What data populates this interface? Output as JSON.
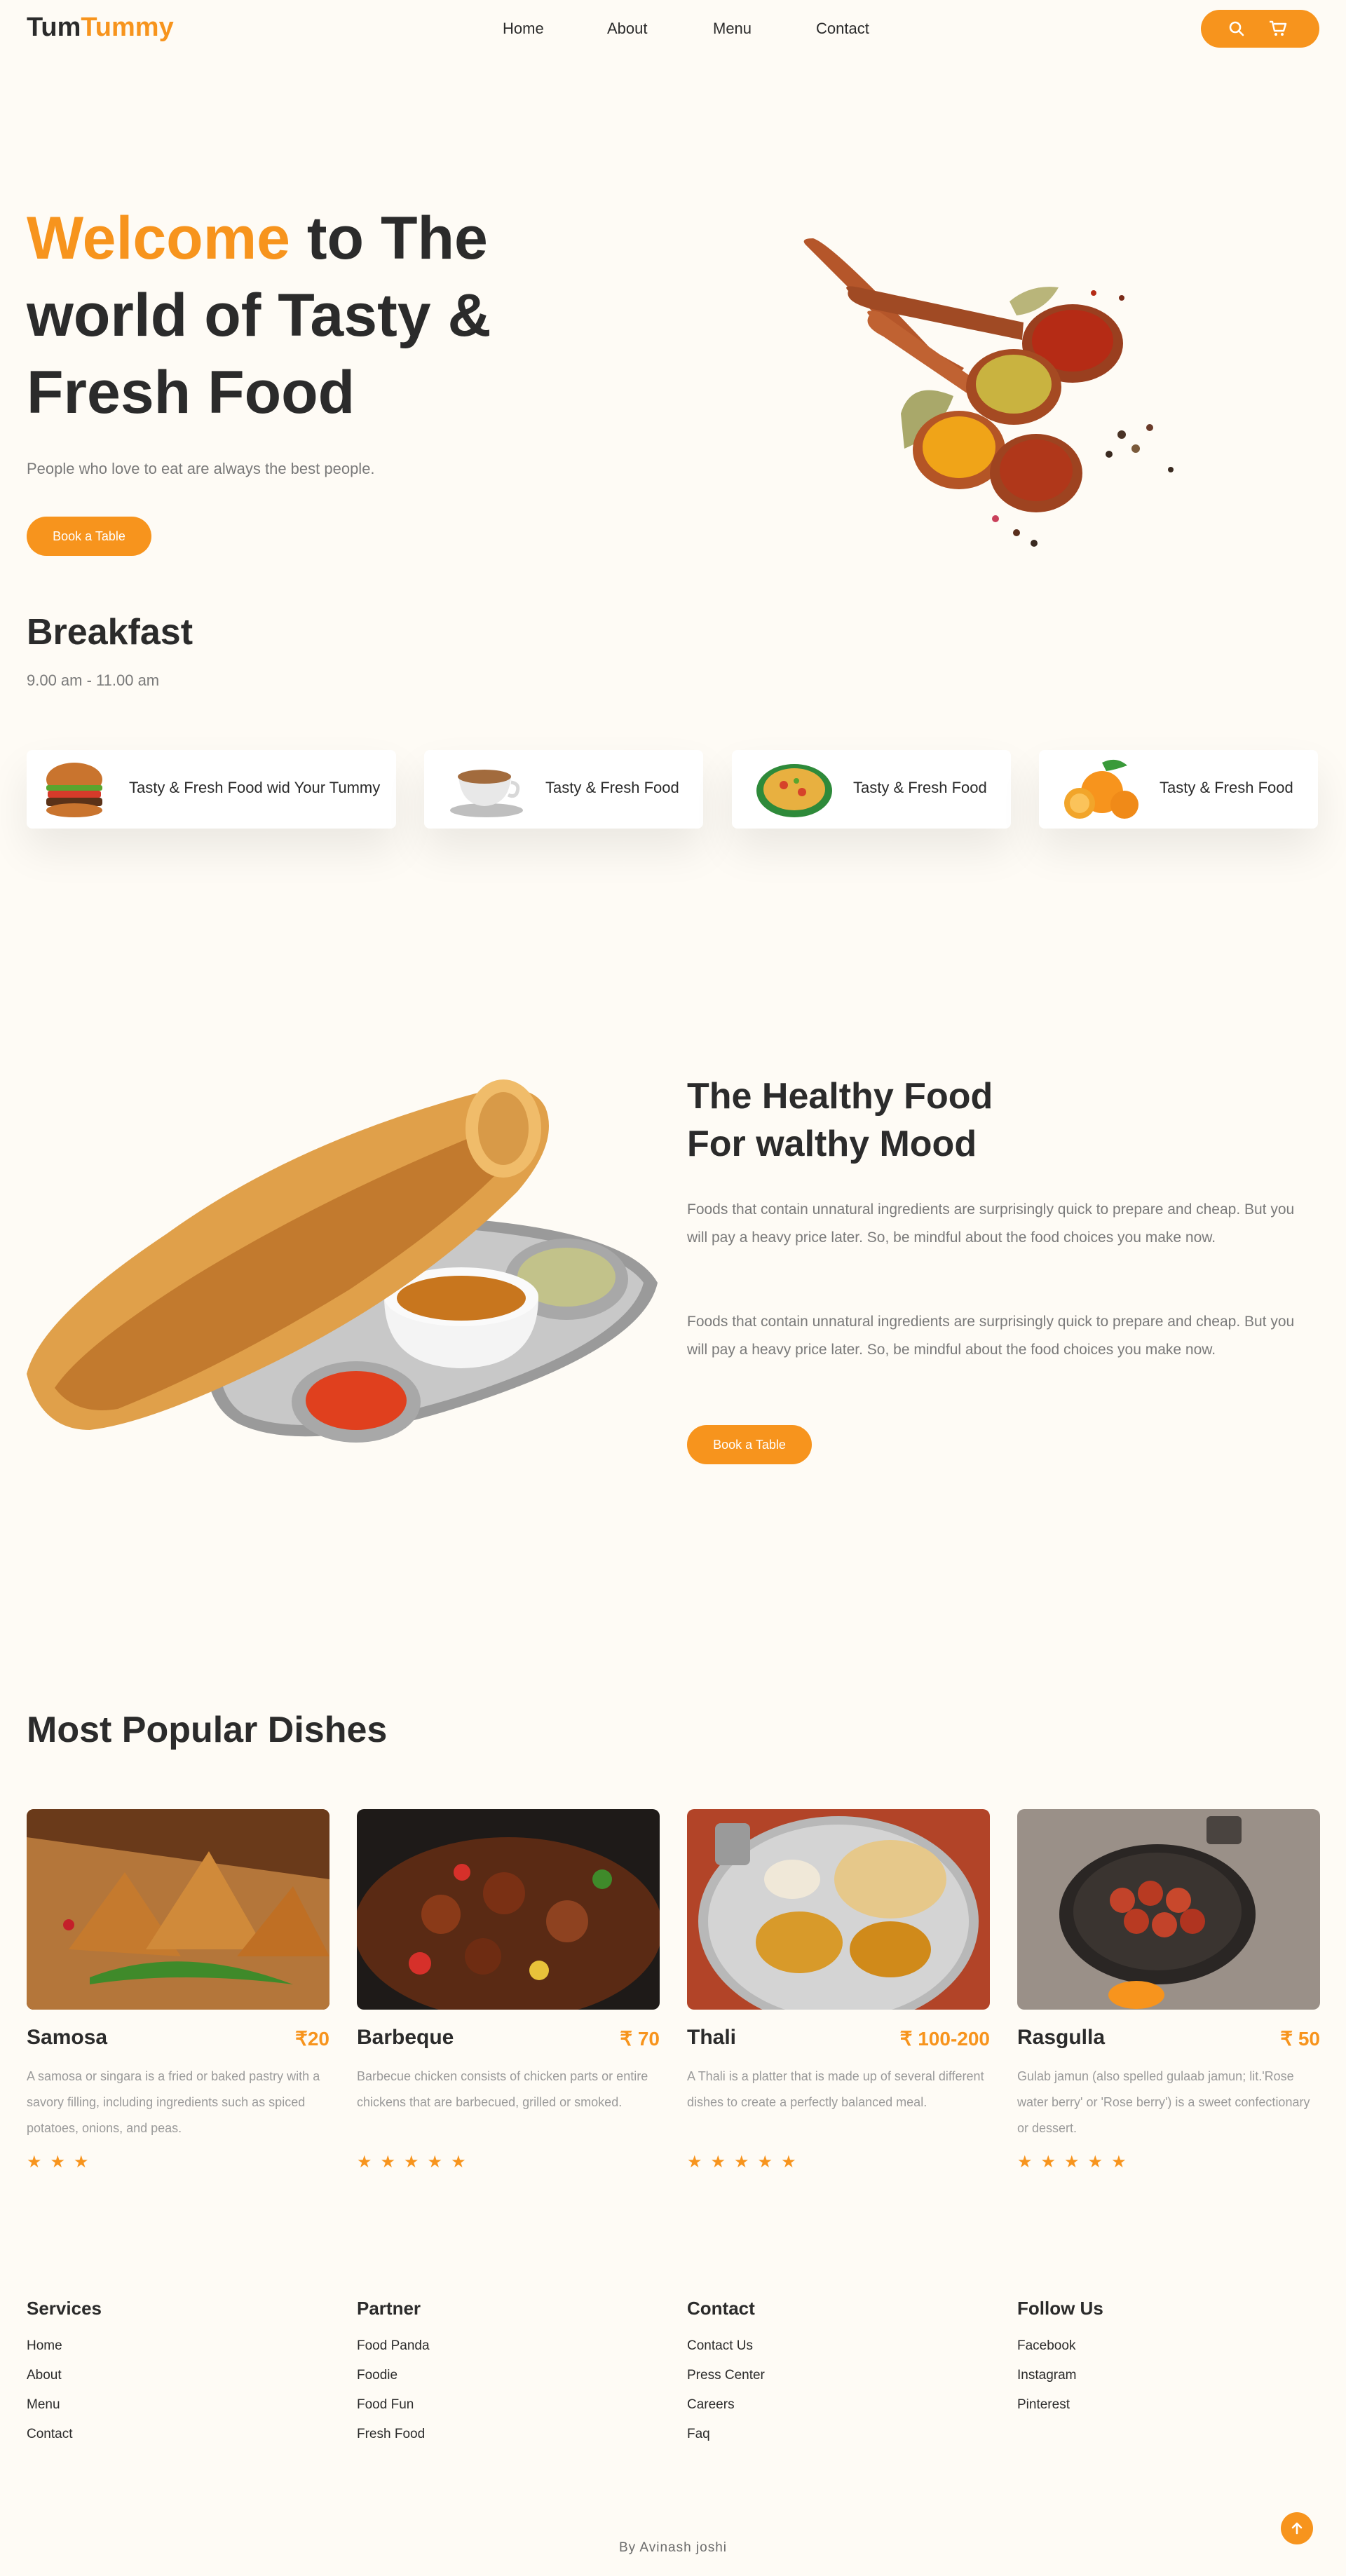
{
  "header": {
    "logo_part1": "Tum",
    "logo_part2": "Tummy",
    "nav": [
      "Home",
      "About",
      "Menu",
      "Contact"
    ],
    "icons": [
      "search-icon",
      "cart-icon"
    ]
  },
  "hero": {
    "title_accent": "Welcome",
    "title_rest": " to The world of Tasty & Fresh Food",
    "subtitle": "People who love to eat are always the best people.",
    "button": "Book a Table"
  },
  "breakfast": {
    "title": "Breakfast",
    "time": "9.00 am - 11.00 am",
    "cards": [
      {
        "label": "Tasty & Fresh Food wid Your Tummy",
        "image": "burger"
      },
      {
        "label": "Tasty & Fresh Food",
        "image": "coffee-cup"
      },
      {
        "label": "Tasty & Fresh Food",
        "image": "rice-bowl"
      },
      {
        "label": "Tasty & Fresh Food",
        "image": "oranges"
      }
    ]
  },
  "healthy": {
    "title_line1": "The Healthy Food",
    "title_line2": "For walthy Mood",
    "para1": "Foods that contain unnatural ingredients are surprisingly quick to prepare and cheap. But you will pay a heavy price later. So, be mindful about the food choices you make now.",
    "para2": "Foods that contain unnatural ingredients are surprisingly quick to prepare and cheap. But you will pay a heavy price later. So, be mindful about the food choices you make now.",
    "button": "Book a Table"
  },
  "popular": {
    "title": "Most Popular Dishes",
    "dishes": [
      {
        "name": "Samosa",
        "price": "₹20",
        "desc": "A samosa or singara is a fried or baked pastry with a savory filling, including ingredients such as spiced potatoes, onions, and peas.",
        "stars": "★★★",
        "rating": 3
      },
      {
        "name": "Barbeque",
        "price": "₹ 70",
        "desc": "Barbecue chicken consists of chicken parts or entire chickens that are barbecued, grilled or smoked.",
        "stars": "★★★★★",
        "rating": 5
      },
      {
        "name": "Thali",
        "price": "₹ 100-200",
        "desc": "A Thali is a platter that is made up of several different dishes to create a perfectly balanced meal.",
        "stars": "★★★★★",
        "rating": 5
      },
      {
        "name": "Rasgulla",
        "price": "₹ 50",
        "desc": "Gulab jamun (also spelled gulaab jamun; lit.'Rose water berry' or 'Rose berry') is a sweet confectionary or dessert.",
        "stars": "★★★★★",
        "rating": 5
      }
    ]
  },
  "footer": {
    "columns": [
      {
        "heading": "Services",
        "links": [
          "Home",
          "About",
          "Menu",
          "Contact"
        ]
      },
      {
        "heading": "Partner",
        "links": [
          "Food Panda",
          "Foodie",
          "Food Fun",
          "Fresh Food"
        ]
      },
      {
        "heading": "Contact",
        "links": [
          "Contact Us",
          "Press Center",
          "Careers",
          "Faq"
        ]
      },
      {
        "heading": "Follow Us",
        "links": [
          "Facebook",
          "Instagram",
          "Pinterest"
        ]
      }
    ],
    "credit": "By Avinash joshi"
  },
  "colors": {
    "accent": "#f7941d",
    "background": "#fefbf5",
    "text": "#2b2b2b",
    "muted": "#7a7a7a"
  }
}
